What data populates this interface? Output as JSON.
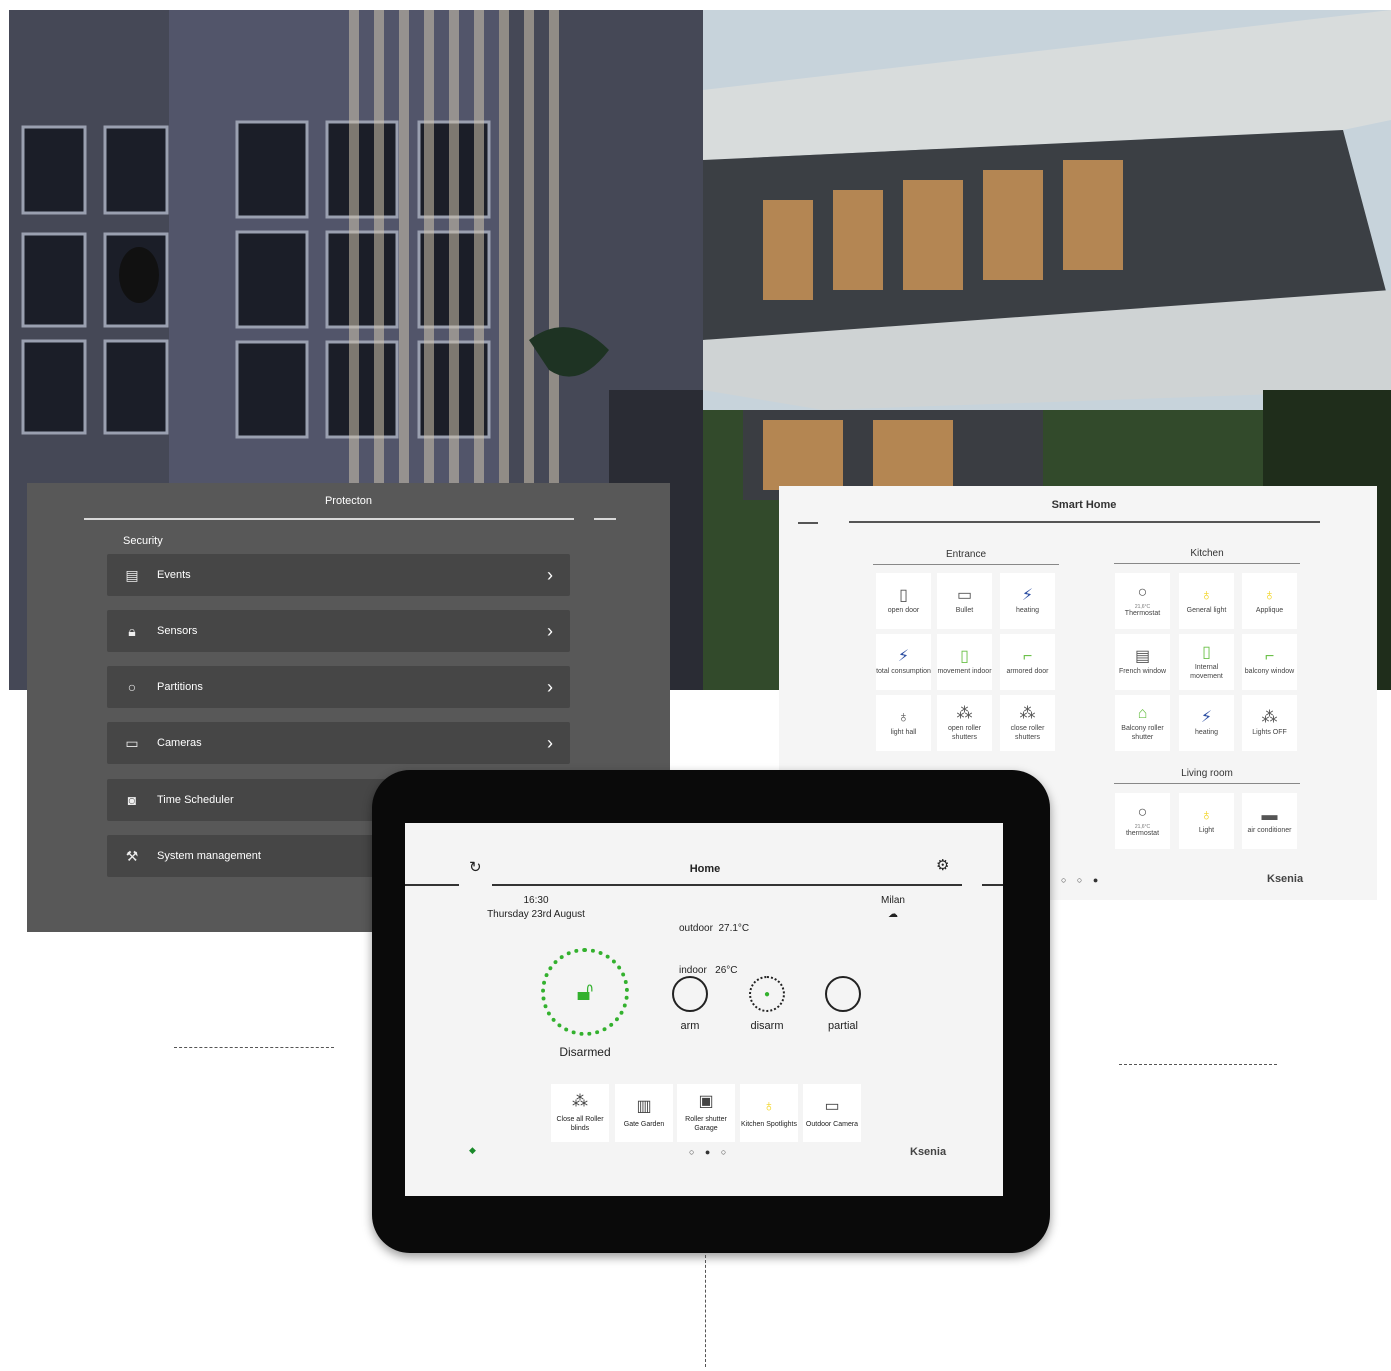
{
  "protection": {
    "title": "Protecton",
    "section": "Security",
    "items": [
      {
        "label": "Events",
        "icon": "document-icon"
      },
      {
        "label": "Sensors",
        "icon": "lock-icon"
      },
      {
        "label": "Partitions",
        "icon": "circle-icon"
      },
      {
        "label": "Cameras",
        "icon": "camera-icon"
      },
      {
        "label": "Time Scheduler",
        "icon": "scheduler-icon"
      },
      {
        "label": "System management",
        "icon": "tools-icon"
      }
    ],
    "chevron": "›"
  },
  "smart_home": {
    "title": "Smart Home",
    "rooms": {
      "entrance": {
        "title": "Entrance",
        "tiles": [
          {
            "label": "open door",
            "icon": "door-icon"
          },
          {
            "label": "Bullet",
            "icon": "camera-icon"
          },
          {
            "label": "heating",
            "icon": "lightning-icon"
          },
          {
            "label": "total consumption",
            "icon": "lightning-icon"
          },
          {
            "label": "movement indoor",
            "icon": "motion-sensor-icon"
          },
          {
            "label": "armored door",
            "icon": "door-sensor-icon"
          },
          {
            "label": "light hall",
            "icon": "bulb-icon"
          },
          {
            "label": "open roller shutters",
            "icon": "scenario-icon"
          },
          {
            "label": "close roller shutters",
            "icon": "scenario-icon"
          }
        ]
      },
      "kitchen": {
        "title": "Kitchen",
        "tiles": [
          {
            "label": "Thermostat",
            "sub": "21,6°C",
            "icon": "thermostat-icon"
          },
          {
            "label": "General light",
            "icon": "bulb-icon"
          },
          {
            "label": "Applique",
            "icon": "bulb-icon"
          },
          {
            "label": "French window",
            "icon": "window-icon"
          },
          {
            "label": "Internal movement",
            "icon": "motion-sensor-icon"
          },
          {
            "label": "balcony window",
            "icon": "door-sensor-icon"
          },
          {
            "label": "Balcony roller shutter",
            "icon": "home-icon"
          },
          {
            "label": "heating",
            "icon": "lightning-icon"
          },
          {
            "label": "Lights OFF",
            "icon": "scenario-icon"
          }
        ]
      },
      "living": {
        "title": "Living room",
        "tiles": [
          {
            "label": "thermostat",
            "sub": "21,6°C",
            "icon": "thermostat-icon"
          },
          {
            "label": "Light",
            "icon": "bulb-icon"
          },
          {
            "label": "air conditioner",
            "icon": "air-conditioner-icon"
          }
        ]
      }
    },
    "pager": "○ ○ ●",
    "logo": "Ksenia"
  },
  "tablet": {
    "title": "Home",
    "time": "16:30",
    "date": "Thursday 23rd August",
    "outdoor": "outdoor  27.1°C",
    "indoor": "indoor   26°C",
    "city": "Milan",
    "weather_icon": "cloud-icon",
    "status": "Disarmed",
    "modes": [
      "arm",
      "disarm",
      "partial"
    ],
    "quick_tiles": [
      {
        "label": "Close all Roller blinds",
        "icon": "scenario-icon"
      },
      {
        "label": "Gate Garden",
        "icon": "gate-icon"
      },
      {
        "label": "Roller shutter Garage",
        "icon": "shutter-icon"
      },
      {
        "label": "Kitchen Spotlights",
        "icon": "bulb-icon"
      },
      {
        "label": "Outdoor Camera",
        "icon": "camera-icon"
      }
    ],
    "pager": "○ ● ○",
    "logo": "Ksenia"
  },
  "colors": {
    "accent_green": "#33b12e",
    "bulb_yellow": "#f2d31e",
    "bolt_blue": "#2d4fa3",
    "dark_panel": "#585858"
  }
}
